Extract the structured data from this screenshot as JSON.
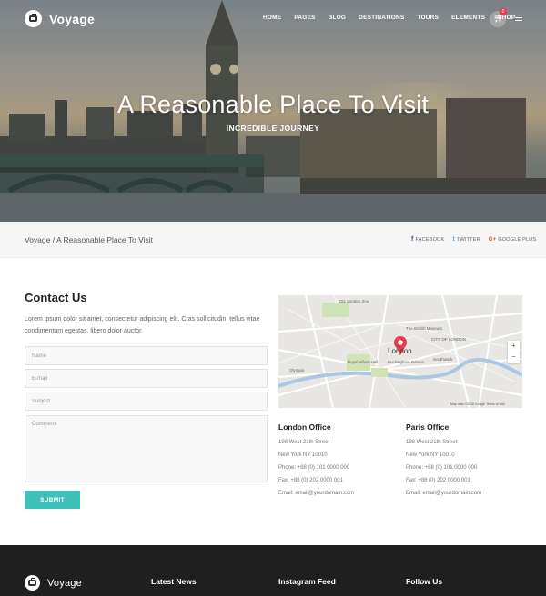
{
  "header": {
    "brand": "Voyage",
    "menu": [
      "HOME",
      "PAGES",
      "BLOG",
      "DESTINATIONS",
      "TOURS",
      "ELEMENTS",
      "SHOP"
    ],
    "cart_count": "0"
  },
  "hero": {
    "title": "A Reasonable Place To Visit",
    "subtitle": "INCREDIBLE JOURNEY"
  },
  "breadcrumb": {
    "home": "Voyage",
    "separator": " / ",
    "current": "A Reasonable Place To Visit"
  },
  "share": [
    {
      "icon": "facebook-icon",
      "glyph": "f",
      "label": "FACEBOOK"
    },
    {
      "icon": "twitter-icon",
      "glyph": "t",
      "label": "TWITTER"
    },
    {
      "icon": "google-plus-icon",
      "glyph": "G+",
      "label": "GOOGLE PLUS"
    }
  ],
  "contact": {
    "title": "Contact Us",
    "text": "Lorem ipsum dolor sit amet, consectetur adipiscing elit. Cras sollicitudin, tellus vitae condimentum egestas, libero dolor auctor.",
    "fields": {
      "name": "Name",
      "email": "E-mail",
      "subject": "Subject",
      "comment": "Comment"
    },
    "submit": "SUBMIT"
  },
  "map": {
    "city_label": "London",
    "places": [
      "ZSL London Zoo",
      "The British Museum",
      "CITY OF LONDON",
      "Southwark",
      "Royal Albert Hall",
      "Buckingham Palace",
      "Olympia"
    ],
    "credit": "Map data ©2018 Google   Terms of Use",
    "zoom_in": "+",
    "zoom_out": "−"
  },
  "offices": [
    {
      "title": "London Office",
      "address": "198 West 21th Street",
      "city": "New York NY 10010",
      "phone": "Phone: +88 (0) 101 0000 000",
      "fax": "Fax: +88 (0) 202 0000 001",
      "email": "Email: email@yourdomain.com"
    },
    {
      "title": "Paris Office",
      "address": "198 West 21th Street",
      "city": "New York NY 10010",
      "phone": "Phone: +88 (0) 101 0000 000",
      "fax": "Fax: +88 (0) 202 0000 001",
      "email": "Email: email@yourdomain.com"
    }
  ],
  "footer": {
    "brand": "Voyage",
    "columns": [
      "Latest News",
      "Instagram Feed",
      "Follow Us"
    ]
  },
  "colors": {
    "accent": "#3fc0b8",
    "footer_bg": "#1f1f1f",
    "map_pin": "#e33c4d"
  }
}
